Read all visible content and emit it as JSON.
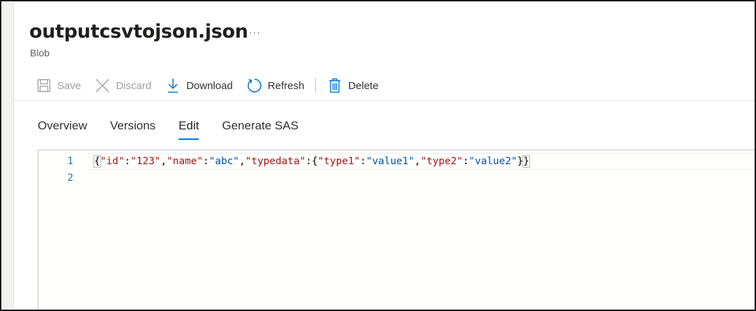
{
  "blob": {
    "title": "outputcsvtojson.json",
    "more_label": "···",
    "type_label": "Blob"
  },
  "toolbar": {
    "save_label": "Save",
    "discard_label": "Discard",
    "download_label": "Download",
    "refresh_label": "Refresh",
    "delete_label": "Delete"
  },
  "tabs": [
    {
      "label": "Overview",
      "active": false
    },
    {
      "label": "Versions",
      "active": false
    },
    {
      "label": "Edit",
      "active": true
    },
    {
      "label": "Generate SAS",
      "active": false
    }
  ],
  "editor": {
    "line_numbers": [
      "1",
      "2"
    ],
    "line1": {
      "open_brace": "{",
      "t1": "\"id\"",
      "t2": ":",
      "t3": "\"123\"",
      "t4": ",",
      "t5": "\"name\"",
      "t6": ":",
      "t7": "\"abc\"",
      "t8": ",",
      "t9": "\"typedata\"",
      "t10": ":{",
      "t11": "\"type1\"",
      "t12": ":",
      "t13": "\"value1\"",
      "t14": ",",
      "t15": "\"type2\"",
      "t16": ":",
      "t17": "\"value2\"",
      "t18": "}",
      "close_brace": "}"
    }
  },
  "colors": {
    "accent": "#0078d4",
    "key": "#a31515",
    "string_value": "#0451a5",
    "line_number": "#237893"
  },
  "icons": {
    "save": "save-icon",
    "discard": "discard-icon",
    "download": "download-icon",
    "refresh": "refresh-icon",
    "delete": "delete-icon"
  }
}
